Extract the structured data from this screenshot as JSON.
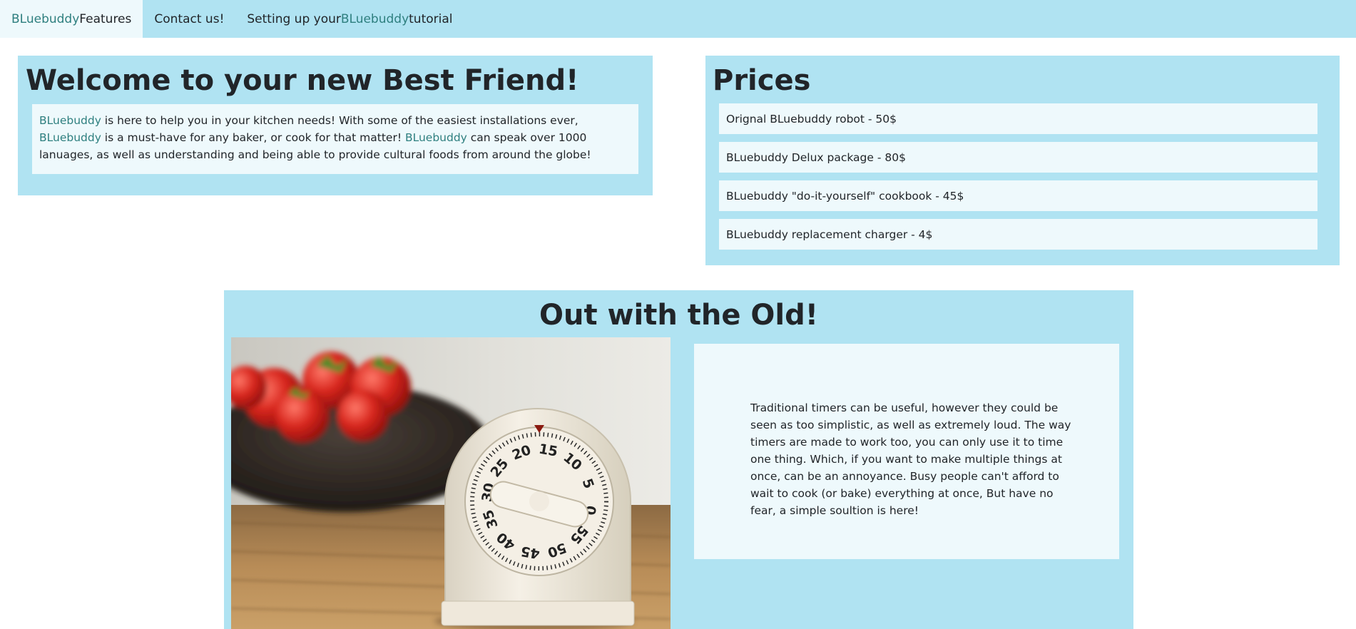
{
  "nav": {
    "items": [
      {
        "brand": "BLuebuddy",
        "label": " Features",
        "suffix": ""
      },
      {
        "brand": "",
        "label": "Contact us!",
        "suffix": ""
      },
      {
        "brand": "BLuebuddy",
        "prefix": "Setting up your ",
        "suffix": " tutorial"
      }
    ]
  },
  "welcome": {
    "title": "Welcome to your new Best Friend!",
    "brand": "BLuebuddy",
    "text_1": " is here to help you in your kitchen needs! With some of the easiest installations ever, ",
    "text_2": " is a must-have for any baker, or cook for that matter! ",
    "text_3": " can speak over 1000 lanuages, as well as understanding and being able to provide cultural foods from around the globe!"
  },
  "prices": {
    "title": "Prices",
    "items": [
      "Orignal BLuebuddy robot - 50$",
      "BLuebuddy Delux package - 80$",
      "BLuebuddy \"do-it-yourself\" cookbook - 45$",
      "BLuebuddy replacement charger - 4$"
    ]
  },
  "old": {
    "title": "Out with the Old!",
    "text": "Traditional timers can be useful, however they could be seen as too simplistic, as well as extremely loud. The way timers are made to work too, you can only use it to time one thing. Which, if you want to make multiple things at once, can be an annoyance. Busy people can't afford to wait to cook (or bake) everything at once, But have no fear, a simple soultion is here!",
    "timer_numbers": [
      "15",
      "10",
      "5",
      "0",
      "55",
      "50",
      "45",
      "40",
      "35",
      "30",
      "25",
      "20"
    ]
  },
  "colors": {
    "panel": "#b0e3f2",
    "inner": "#eef9fc",
    "brand": "#2e7f7f"
  }
}
